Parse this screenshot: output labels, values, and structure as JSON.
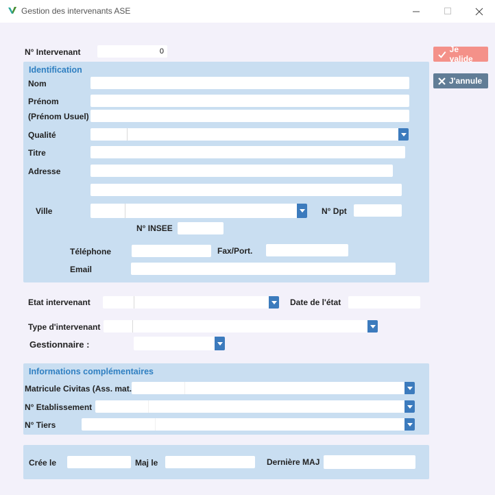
{
  "window": {
    "title": "Gestion des intervenants ASE",
    "minimize_icon": "minimize-icon",
    "maximize_icon": "maximize-icon",
    "close_icon": "close-icon"
  },
  "actions": {
    "validate_label": "Je valide",
    "cancel_label": "J'annule"
  },
  "intervenant": {
    "number_label": "N° Intervenant",
    "number_value": "0"
  },
  "identification": {
    "title": "Identification",
    "nom_label": "Nom",
    "prenom_label": "Prénom",
    "prenom_usuel_label": "(Prénom Usuel)",
    "qualite_label": "Qualité",
    "titre_label": "Titre",
    "adresse_label": "Adresse",
    "ville_label": "Ville",
    "dpt_label": "N° Dpt",
    "insee_label": "N° INSEE",
    "telephone_label": "Téléphone",
    "fax_label": "Fax/Port.",
    "email_label": "Email"
  },
  "status": {
    "etat_label": "Etat intervenant",
    "date_etat_label": "Date de l'état",
    "type_label": "Type d'intervenant",
    "gestionnaire_label": "Gestionnaire :"
  },
  "complementary": {
    "title": "Informations complémentaires",
    "matricule_label": "Matricule Civitas (Ass. mat.)",
    "etablissement_label": "N° Etablissement",
    "tiers_label": "N° Tiers"
  },
  "audit": {
    "created_label": "Crée le",
    "modified_label": "Maj le",
    "last_update_label": "Dernière MAJ"
  },
  "colors": {
    "panel": "#c9def1",
    "accent": "#2f7fc1",
    "validate": "#f49189",
    "cancel": "#617d96",
    "dropdown": "#3c7bbd"
  }
}
